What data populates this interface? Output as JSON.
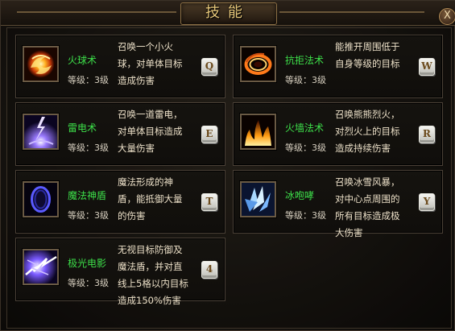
{
  "window": {
    "title": "技能",
    "close_label": "X"
  },
  "skills": [
    {
      "name": "火球术",
      "level": "等级：3级",
      "description": "召唤一个小火球，对单体目标造成伤害",
      "hotkey": "Q",
      "icon": "fireball-icon"
    },
    {
      "name": "抗拒法术",
      "level": "等级：3级",
      "description": "能推开周围低于自身等级的目标",
      "hotkey": "W",
      "icon": "repel-ring-icon"
    },
    {
      "name": "雷电术",
      "level": "等级：3级",
      "description": "召唤一道雷电，对单体目标造成大量伤害",
      "hotkey": "E",
      "icon": "lightning-icon"
    },
    {
      "name": "火墙法术",
      "level": "等级：3级",
      "description": "召唤熊熊烈火，对烈火上的目标造成持续伤害",
      "hotkey": "R",
      "icon": "firewall-icon"
    },
    {
      "name": "魔法神盾",
      "level": "等级：3级",
      "description": "魔法形成的神盾，能抵御大量的伤害",
      "hotkey": "T",
      "icon": "magic-shield-icon"
    },
    {
      "name": "冰咆哮",
      "level": "等级：3级",
      "description": "召唤冰雪风暴，对中心点周围的所有目标造成极大伤害",
      "hotkey": "Y",
      "icon": "ice-storm-icon"
    },
    {
      "name": "极光电影",
      "level": "等级：3级",
      "description": "无视目标防御及魔法盾，并对直线上5格以内目标造成150%伤害",
      "hotkey": "4",
      "icon": "aurora-lightning-icon"
    }
  ]
}
